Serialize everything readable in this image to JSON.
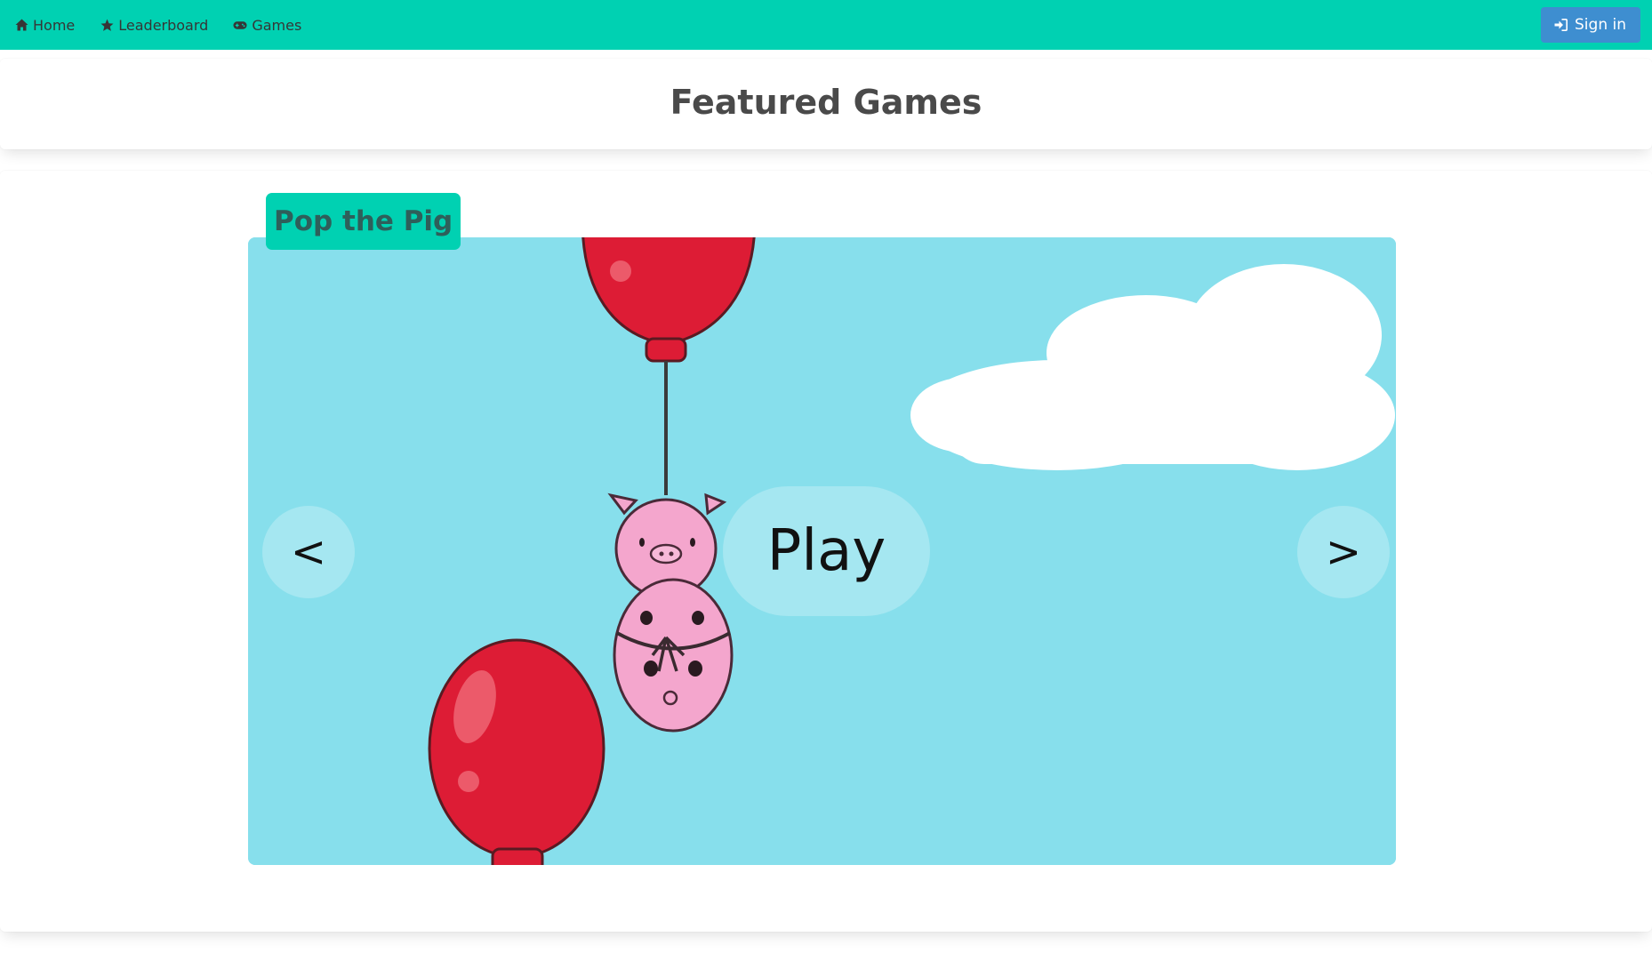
{
  "navbar": {
    "items": [
      {
        "label": "Home",
        "icon": "home-icon"
      },
      {
        "label": "Leaderboard",
        "icon": "star-icon"
      },
      {
        "label": "Games",
        "icon": "gamepad-icon"
      }
    ],
    "signin_label": "Sign in",
    "signin_icon": "sign-in-icon"
  },
  "header": {
    "title": "Featured Games"
  },
  "carousel": {
    "game_title": "Pop the Pig",
    "prev_label": "<",
    "next_label": ">",
    "play_label": "Play"
  },
  "colors": {
    "navbar": "#00d1b2",
    "signin_button": "#3e8ed0",
    "game_background": "#87dfec",
    "balloon": "#dd1c35",
    "pig": "#f4a6cd"
  }
}
